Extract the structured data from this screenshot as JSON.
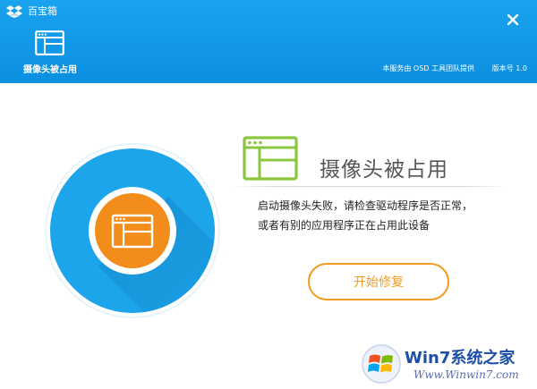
{
  "window": {
    "title": "百宝箱",
    "close_label": "×"
  },
  "header": {
    "nav_tab_label": "摄像头被占用",
    "service_info": "本服务由 OSD 工具团队提供",
    "version_info": "版本号 1.0"
  },
  "status": {
    "title": "摄像头被占用",
    "description_line1": "启动摄像头失败，请检查驱动程序是否正常，",
    "description_line2": "或者有别的应用程序正在占用此设备"
  },
  "actions": {
    "repair_label": "开始修复"
  },
  "watermark": {
    "brand_text": "Win7系统之家",
    "url": "Www.Winwin7.com"
  },
  "colors": {
    "header_blue": "#0b8fe0",
    "circle_blue": "#1ca5ea",
    "accent_orange": "#f39b1f",
    "status_green": "#8cc63f"
  }
}
